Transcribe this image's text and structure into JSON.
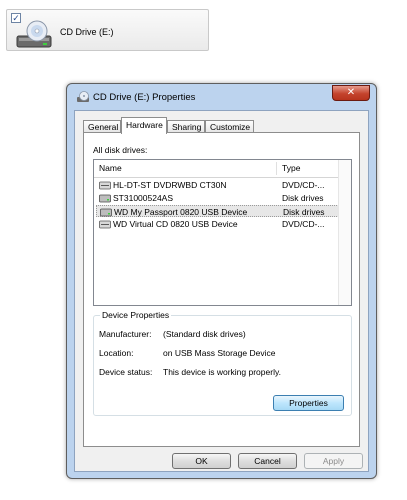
{
  "tile": {
    "label": "CD Drive (E:)",
    "checked": "✓"
  },
  "dialog": {
    "title": "CD Drive (E:) Properties",
    "close_glyph": "✕",
    "tabs": [
      {
        "label": "General"
      },
      {
        "label": "Hardware"
      },
      {
        "label": "Sharing"
      },
      {
        "label": "Customize"
      }
    ],
    "active_tab": "Hardware",
    "all_disk_drives_label": "All disk drives:",
    "columns": {
      "name": "Name",
      "type": "Type"
    },
    "drives": [
      {
        "name": "HL-DT-ST DVDRWBD CT30N",
        "type": "DVD/CD-...",
        "icon": "optical-drive-icon"
      },
      {
        "name": "ST31000524AS",
        "type": "Disk drives",
        "icon": "hard-disk-icon"
      },
      {
        "name": "WD My Passport 0820 USB Device",
        "type": "Disk drives",
        "icon": "hard-disk-icon"
      },
      {
        "name": "WD Virtual CD 0820 USB Device",
        "type": "DVD/CD-...",
        "icon": "optical-drive-icon"
      }
    ],
    "selected_drive": "WD My Passport 0820 USB Device",
    "device_properties": {
      "title": "Device Properties",
      "manufacturer_label": "Manufacturer:",
      "manufacturer_value": "(Standard disk drives)",
      "location_label": "Location:",
      "location_value": "on USB Mass Storage Device",
      "status_label": "Device status:",
      "status_value": "This device is working properly.",
      "properties_button": "Properties"
    },
    "buttons": {
      "ok": "OK",
      "cancel": "Cancel",
      "apply": "Apply"
    }
  },
  "colors": {
    "close_red": "#c4432d",
    "frame_blue": "#bcd3ee",
    "focus_blue": "#bee6fd"
  }
}
